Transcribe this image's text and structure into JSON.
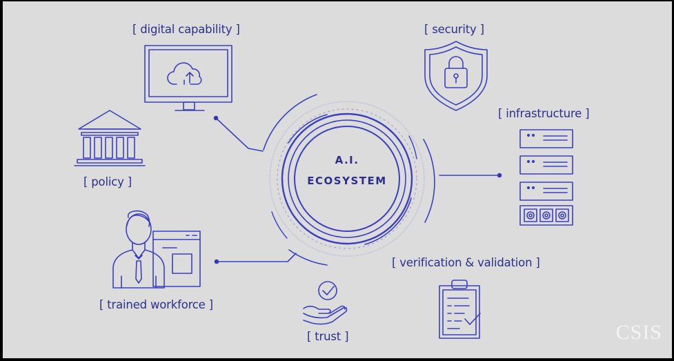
{
  "hub": {
    "line1": "A.I.",
    "line2": "ECOSYSTEM"
  },
  "nodes": {
    "digital_capability": "[ digital capability ]",
    "security": "[ security ]",
    "infrastructure": "[ infrastructure ]",
    "policy": "[ policy ]",
    "trained_workforce": "[ trained workforce ]",
    "verification_validation": "[ verification & validation ]",
    "trust": "[ trust ]"
  },
  "logo": "CSIS",
  "colors": {
    "background": "#dcdcdc",
    "line": "#2d2f8a",
    "accent": "#3b3fbf"
  }
}
